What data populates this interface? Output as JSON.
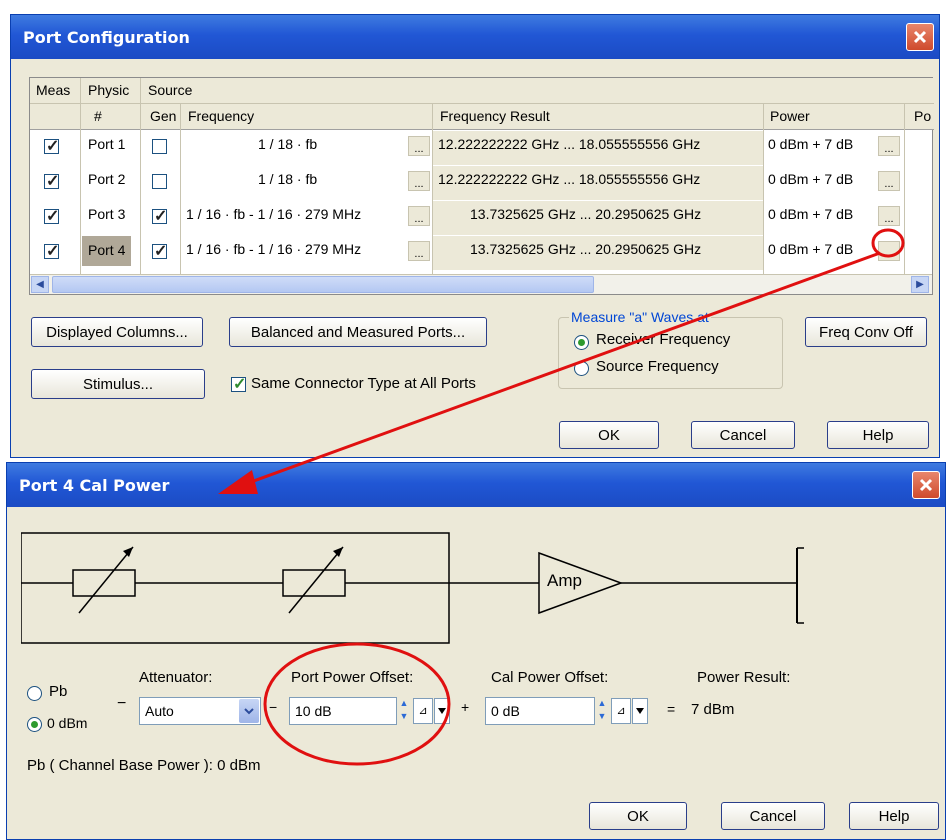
{
  "port_config": {
    "title": "Port Configuration",
    "headers": {
      "meas": "Meas",
      "physical": "Physic",
      "source": "Source",
      "num": "#",
      "gen": "Gen",
      "frequency": "Frequency",
      "freq_result": "Frequency Result",
      "power": "Power",
      "po": "Po"
    },
    "rows": [
      {
        "port": "Port 1",
        "meas": true,
        "gen": false,
        "frequency": "1 / 18 · fb",
        "result": "12.222222222 GHz ... 18.055555556 GHz",
        "power": "0 dBm + 7 dB"
      },
      {
        "port": "Port 2",
        "meas": true,
        "gen": false,
        "frequency": "1 / 18 · fb",
        "result": "12.222222222 GHz ... 18.055555556 GHz",
        "power": "0 dBm + 7 dB"
      },
      {
        "port": "Port 3",
        "meas": true,
        "gen": true,
        "frequency": "1 / 16 · fb - 1 / 16 · 279 MHz",
        "result": "13.7325625 GHz ... 20.2950625 GHz",
        "power": "0 dBm + 7 dB"
      },
      {
        "port": "Port 4",
        "meas": true,
        "gen": true,
        "frequency": "1 / 16 · fb - 1 / 16 · 279 MHz",
        "result": "13.7325625 GHz ... 20.2950625 GHz",
        "power": "0 dBm + 7 dB"
      }
    ],
    "ellipsis": "...",
    "buttons": {
      "displayed_columns": "Displayed Columns...",
      "balanced": "Balanced and Measured Ports...",
      "stimulus": "Stimulus...",
      "freq_conv": "Freq Conv Off",
      "ok": "OK",
      "cancel": "Cancel",
      "help": "Help"
    },
    "same_connector": "Same Connector Type at All Ports",
    "same_connector_checked": true,
    "measure_group": {
      "title": "Measure \"a\" Waves at",
      "options": [
        "Receiver Frequency",
        "Source Frequency"
      ],
      "selected": 0
    }
  },
  "cal_power": {
    "title": "Port 4 Cal Power",
    "amp_label": "Amp",
    "pb_option": "Pb",
    "dbm_option": "0 dBm",
    "minus": "−",
    "plus": "+",
    "equals": "=",
    "attenuator_label": "Attenuator:",
    "attenuator_value": "Auto",
    "port_offset_label": "Port Power Offset:",
    "port_offset_value": "10 dB",
    "cal_offset_label": "Cal Power Offset:",
    "cal_offset_value": "0 dB",
    "power_result_label": "Power Result:",
    "power_result_value": "7 dBm",
    "base_power": "Pb ( Channel Base Power ): 0 dBm",
    "buttons": {
      "ok": "OK",
      "cancel": "Cancel",
      "help": "Help"
    }
  },
  "colors": {
    "annotation": "#e01010",
    "title_bar": "#2157d5",
    "dialog_bg": "#ece9d8"
  }
}
